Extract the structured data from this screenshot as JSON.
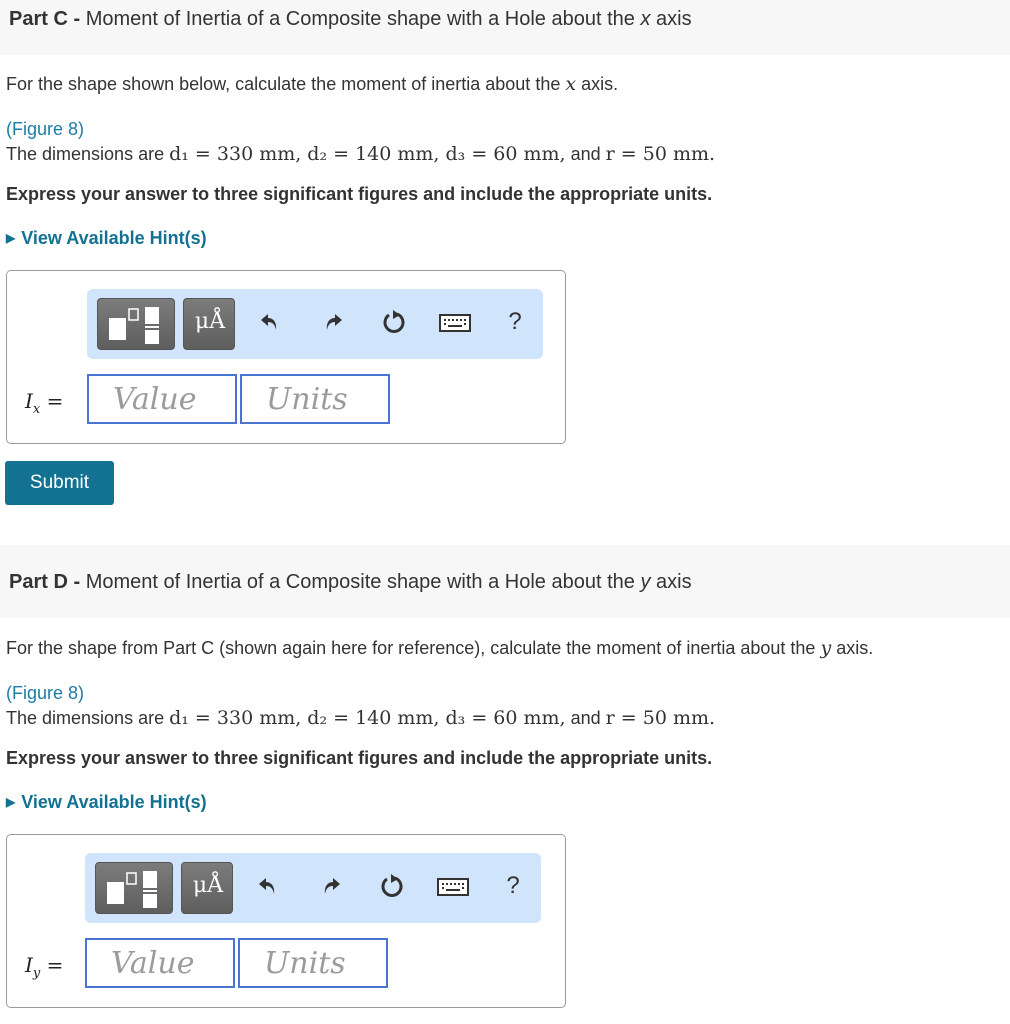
{
  "partC": {
    "label": "Part C -",
    "title_pre": "Moment of Inertia of a Composite shape with a Hole about the",
    "axis": "x",
    "title_post": "axis",
    "prompt_pre": "For the shape shown below, calculate the moment of inertia about the",
    "prompt_axis": "x",
    "prompt_post": "axis.",
    "figure_link": "(Figure 8)",
    "dims_pre": "The dimensions are",
    "dims_math_1": "d₁ = 330 mm, d₂ = 140 mm, d₃ = 60 mm,",
    "dims_and": "and",
    "dims_math_2": "r = 50 mm.",
    "instruction": "Express your answer to three significant figures and include the appropriate units.",
    "hint": "View Available Hint(s)",
    "answer_label": "I",
    "answer_sub": "x",
    "value_placeholder": "Value",
    "units_placeholder": "Units",
    "submit": "Submit"
  },
  "partD": {
    "label": "Part D -",
    "title_pre": "Moment of Inertia of a Composite shape with a Hole about the",
    "axis": "y",
    "title_post": "axis",
    "prompt_pre": "For the shape from Part C (shown again here for reference), calculate the moment of inertia about the",
    "prompt_axis": "y",
    "prompt_post": "axis.",
    "figure_link": "(Figure 8)",
    "dims_pre": "The dimensions are",
    "dims_math_1": "d₁ = 330 mm, d₂ = 140 mm, d₃ = 60 mm,",
    "dims_and": "and",
    "dims_math_2": "r = 50 mm.",
    "instruction": "Express your answer to three significant figures and include the appropriate units.",
    "hint": "View Available Hint(s)",
    "answer_label": "I",
    "answer_sub": "y",
    "value_placeholder": "Value",
    "units_placeholder": "Units"
  },
  "toolbar": {
    "units_button": "μÅ",
    "icons": [
      "templates-icon",
      "units-icon",
      "undo-icon",
      "redo-icon",
      "reset-icon",
      "keyboard-icon",
      "help-icon"
    ],
    "help": "?"
  }
}
